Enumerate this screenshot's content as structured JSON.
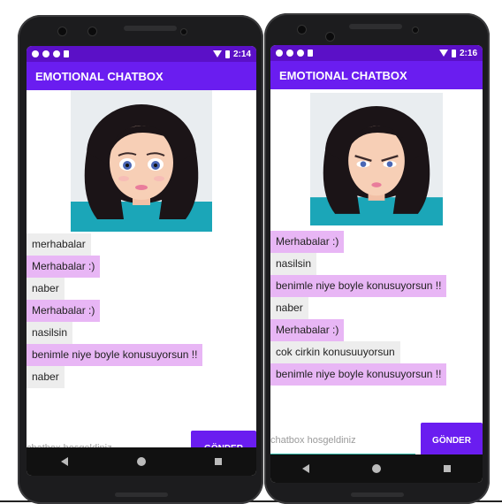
{
  "left": {
    "status": {
      "time": "2:14"
    },
    "app_title": "EMOTIONAL CHATBOX",
    "messages": [
      {
        "text": "merhabalar",
        "from": "user"
      },
      {
        "text": "Merhabalar :)",
        "from": "bot"
      },
      {
        "text": "naber",
        "from": "user"
      },
      {
        "text": "Merhabalar :)",
        "from": "bot"
      },
      {
        "text": "nasilsin",
        "from": "user"
      },
      {
        "text": "benimle niye boyle konusuyorsun !!",
        "from": "bot"
      },
      {
        "text": "naber",
        "from": "user"
      }
    ],
    "input_placeholder": "chatbox hosgeldiniz",
    "send_label": "GÖNDER"
  },
  "right": {
    "status": {
      "time": "2:16"
    },
    "app_title": "EMOTIONAL CHATBOX",
    "messages": [
      {
        "text": "Merhabalar :)",
        "from": "bot"
      },
      {
        "text": "nasilsin",
        "from": "user"
      },
      {
        "text": "benimle niye boyle konusuyorsun !!",
        "from": "bot"
      },
      {
        "text": "naber",
        "from": "user"
      },
      {
        "text": "Merhabalar :)",
        "from": "bot"
      },
      {
        "text": "cok cirkin konusuuyorsun",
        "from": "user"
      },
      {
        "text": "benimle niye boyle konusuyorsun !!",
        "from": "bot"
      }
    ],
    "input_placeholder": "chatbox hosgeldiniz",
    "send_label": "GÖNDER"
  },
  "colors": {
    "primary": "#6a1df0",
    "status": "#5b10c7",
    "bot_bubble": "#e8b6f5",
    "user_bubble": "#ededed"
  }
}
